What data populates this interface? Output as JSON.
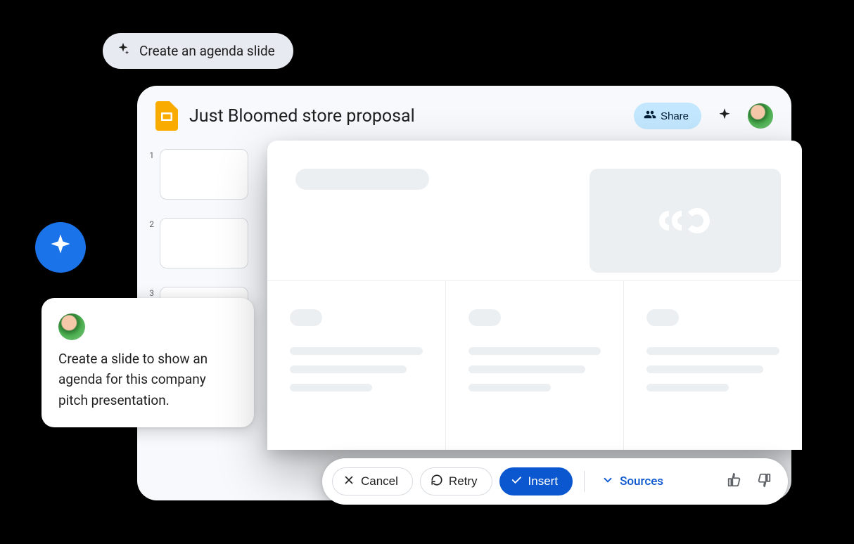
{
  "suggestion": {
    "label": "Create an agenda slide"
  },
  "editor": {
    "doc_title": "Just Bloomed store proposal",
    "share_label": "Share"
  },
  "thumbs": [
    {
      "num": "1"
    },
    {
      "num": "2"
    },
    {
      "num": "3"
    }
  ],
  "prompt": {
    "text": "Create a slide to show an agenda for this company pitch presentation."
  },
  "actions": {
    "cancel": "Cancel",
    "retry": "Retry",
    "insert": "Insert",
    "sources": "Sources"
  }
}
